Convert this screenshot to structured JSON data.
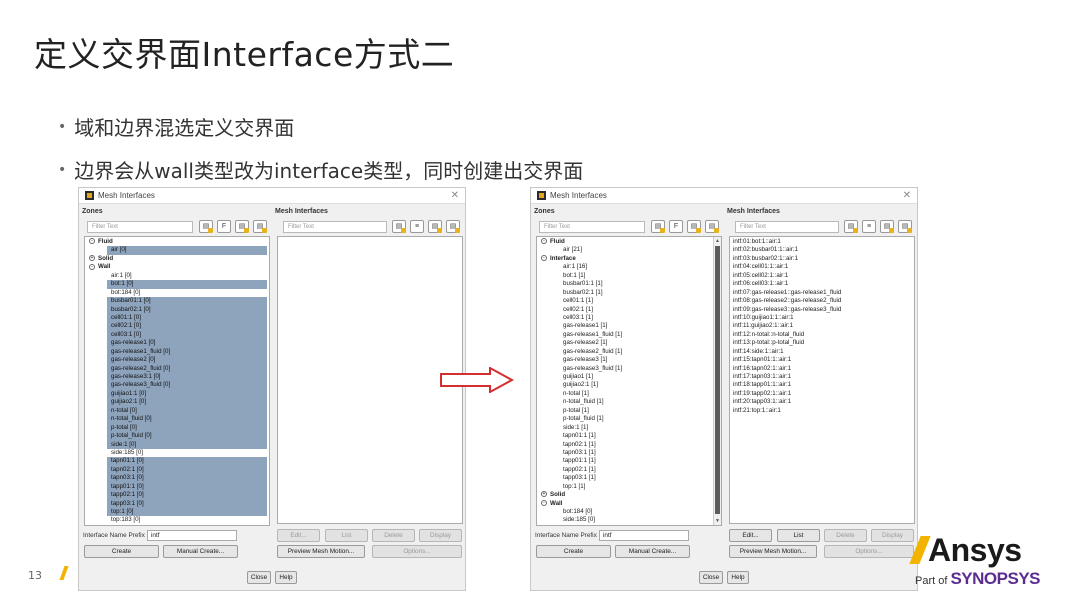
{
  "slide": {
    "title": "定义交界面Interface方式二",
    "bullets": [
      "域和边界混选定义交界面",
      "边界会从wall类型改为interface类型，同时创建出交界面"
    ],
    "page_number": "13"
  },
  "branding": {
    "logo_text": "Ansys",
    "part_of": "Part of",
    "synopsys": "SYNOPSYS"
  },
  "colors": {
    "accent": "#f2b400",
    "selection": "#8ea4bd",
    "arrow": "#d32f2f",
    "synopsys": "#5c2d91"
  },
  "dialog_left": {
    "title": "Mesh Interfaces",
    "zones_label": "Zones",
    "mesh_interfaces_label": "Mesh Interfaces",
    "filter_placeholder": "Filter Text",
    "zone_rows": [
      {
        "text": "Fluid",
        "type": "group",
        "toggle": "-"
      },
      {
        "text": "air  [0]",
        "type": "item",
        "selected": true
      },
      {
        "text": "Solid",
        "type": "group",
        "toggle": "+"
      },
      {
        "text": "Wall",
        "type": "group",
        "toggle": "-"
      },
      {
        "text": "air:1  [0]",
        "type": "item",
        "selected": false
      },
      {
        "text": "bot:1  [0]",
        "type": "item",
        "selected": true
      },
      {
        "text": "bot:184  [0]",
        "type": "item",
        "selected": false
      },
      {
        "text": "busbar01:1  [0]",
        "type": "item",
        "selected": true
      },
      {
        "text": "busbar02:1  [0]",
        "type": "item",
        "selected": true
      },
      {
        "text": "cell01:1  [0]",
        "type": "item",
        "selected": true
      },
      {
        "text": "cell02:1  [0]",
        "type": "item",
        "selected": true
      },
      {
        "text": "cell03:1  [0]",
        "type": "item",
        "selected": true
      },
      {
        "text": "gas-release1  [0]",
        "type": "item",
        "selected": true
      },
      {
        "text": "gas-release1_fluid  [0]",
        "type": "item",
        "selected": true
      },
      {
        "text": "gas-release2  [0]",
        "type": "item",
        "selected": true
      },
      {
        "text": "gas-release2_fluid  [0]",
        "type": "item",
        "selected": true
      },
      {
        "text": "gas-release3:1  [0]",
        "type": "item",
        "selected": true
      },
      {
        "text": "gas-release3_fluid  [0]",
        "type": "item",
        "selected": true
      },
      {
        "text": "guijiao1:1  [0]",
        "type": "item",
        "selected": true
      },
      {
        "text": "guijiao2:1  [0]",
        "type": "item",
        "selected": true
      },
      {
        "text": "n-total  [0]",
        "type": "item",
        "selected": true
      },
      {
        "text": "n-total_fluid  [0]",
        "type": "item",
        "selected": true
      },
      {
        "text": "p-total  [0]",
        "type": "item",
        "selected": true
      },
      {
        "text": "p-total_fluid  [0]",
        "type": "item",
        "selected": true
      },
      {
        "text": "side:1  [0]",
        "type": "item",
        "selected": true
      },
      {
        "text": "side:185  [0]",
        "type": "item",
        "selected": false
      },
      {
        "text": "tapn01:1  [0]",
        "type": "item",
        "selected": true
      },
      {
        "text": "tapn02:1  [0]",
        "type": "item",
        "selected": true
      },
      {
        "text": "tapn03:1  [0]",
        "type": "item",
        "selected": true
      },
      {
        "text": "tapp01:1  [0]",
        "type": "item",
        "selected": true
      },
      {
        "text": "tapp02:1  [0]",
        "type": "item",
        "selected": true
      },
      {
        "text": "tapp03:1  [0]",
        "type": "item",
        "selected": true
      },
      {
        "text": "top:1  [0]",
        "type": "item",
        "selected": true
      },
      {
        "text": "top:183  [0]",
        "type": "item",
        "selected": false
      }
    ],
    "interfaces": [],
    "prefix_label": "Interface Name Prefix",
    "prefix_value": "intf",
    "buttons": {
      "create": "Create",
      "manual_create": "Manual Create...",
      "edit": "Edit...",
      "list": "List",
      "delete": "Delete",
      "display": "Display",
      "preview": "Preview Mesh Motion...",
      "options": "Options...",
      "close": "Close",
      "help": "Help"
    }
  },
  "dialog_right": {
    "title": "Mesh Interfaces",
    "zones_label": "Zones",
    "mesh_interfaces_label": "Mesh Interfaces",
    "filter_placeholder": "Filter Text",
    "zone_rows": [
      {
        "text": "Fluid",
        "type": "group",
        "toggle": "-"
      },
      {
        "text": "air  [21]",
        "type": "item",
        "selected": false
      },
      {
        "text": "Interface",
        "type": "group",
        "toggle": "-"
      },
      {
        "text": "air:1  [16]",
        "type": "item",
        "selected": false
      },
      {
        "text": "bot:1  [1]",
        "type": "item",
        "selected": false
      },
      {
        "text": "busbar01:1  [1]",
        "type": "item",
        "selected": false
      },
      {
        "text": "busbar02:1  [1]",
        "type": "item",
        "selected": false
      },
      {
        "text": "cell01:1  [1]",
        "type": "item",
        "selected": false
      },
      {
        "text": "cell02:1  [1]",
        "type": "item",
        "selected": false
      },
      {
        "text": "cell03:1  [1]",
        "type": "item",
        "selected": false
      },
      {
        "text": "gas-release1  [1]",
        "type": "item",
        "selected": false
      },
      {
        "text": "gas-release1_fluid  [1]",
        "type": "item",
        "selected": false
      },
      {
        "text": "gas-release2  [1]",
        "type": "item",
        "selected": false
      },
      {
        "text": "gas-release2_fluid  [1]",
        "type": "item",
        "selected": false
      },
      {
        "text": "gas-release3  [1]",
        "type": "item",
        "selected": false
      },
      {
        "text": "gas-release3_fluid  [1]",
        "type": "item",
        "selected": false
      },
      {
        "text": "guijiao1  [1]",
        "type": "item",
        "selected": false
      },
      {
        "text": "guijiao2:1  [1]",
        "type": "item",
        "selected": false
      },
      {
        "text": "n-total  [1]",
        "type": "item",
        "selected": false
      },
      {
        "text": "n-total_fluid  [1]",
        "type": "item",
        "selected": false
      },
      {
        "text": "p-total  [1]",
        "type": "item",
        "selected": false
      },
      {
        "text": "p-total_fluid  [1]",
        "type": "item",
        "selected": false
      },
      {
        "text": "side:1  [1]",
        "type": "item",
        "selected": false
      },
      {
        "text": "tapn01:1  [1]",
        "type": "item",
        "selected": false
      },
      {
        "text": "tapn02:1  [1]",
        "type": "item",
        "selected": false
      },
      {
        "text": "tapn03:1  [1]",
        "type": "item",
        "selected": false
      },
      {
        "text": "tapp01:1  [1]",
        "type": "item",
        "selected": false
      },
      {
        "text": "tapp02:1  [1]",
        "type": "item",
        "selected": false
      },
      {
        "text": "tapp03:1  [1]",
        "type": "item",
        "selected": false
      },
      {
        "text": "top:1  [1]",
        "type": "item",
        "selected": false
      },
      {
        "text": "Solid",
        "type": "group",
        "toggle": "+"
      },
      {
        "text": "Wall",
        "type": "group",
        "toggle": "-"
      },
      {
        "text": "bot:184  [0]",
        "type": "item",
        "selected": false
      },
      {
        "text": "side:185  [0]",
        "type": "item",
        "selected": false
      }
    ],
    "interfaces": [
      "intf:01:bot:1::air:1",
      "intf:02:busbar01:1::air:1",
      "intf:03:busbar02:1::air:1",
      "intf:04:cell01:1::air:1",
      "intf:05:cell02:1::air:1",
      "intf:06:cell03:1::air:1",
      "intf:07:gas-release1::gas-release1_fluid",
      "intf:08:gas-release2::gas-release2_fluid",
      "intf:09:gas-release3::gas-release3_fluid",
      "intf:10:guijiao1:1::air:1",
      "intf:11:guijiao2:1::air:1",
      "intf:12:n-total::n-total_fluid",
      "intf:13:p-total::p-total_fluid",
      "intf:14:side:1::air:1",
      "intf:15:tapn01:1::air:1",
      "intf:16:tapn02:1::air:1",
      "intf:17:tapn03:1::air:1",
      "intf:18:tapp01:1::air:1",
      "intf:19:tapp02:1::air:1",
      "intf:20:tapp03:1::air:1",
      "intf:21:top:1::air:1"
    ],
    "prefix_label": "Interface Name Prefix",
    "prefix_value": "intf",
    "buttons": {
      "create": "Create",
      "manual_create": "Manual Create...",
      "edit": "Edit...",
      "list": "List",
      "delete": "Delete",
      "display": "Display",
      "preview": "Preview Mesh Motion...",
      "options": "Options...",
      "close": "Close",
      "help": "Help"
    }
  }
}
